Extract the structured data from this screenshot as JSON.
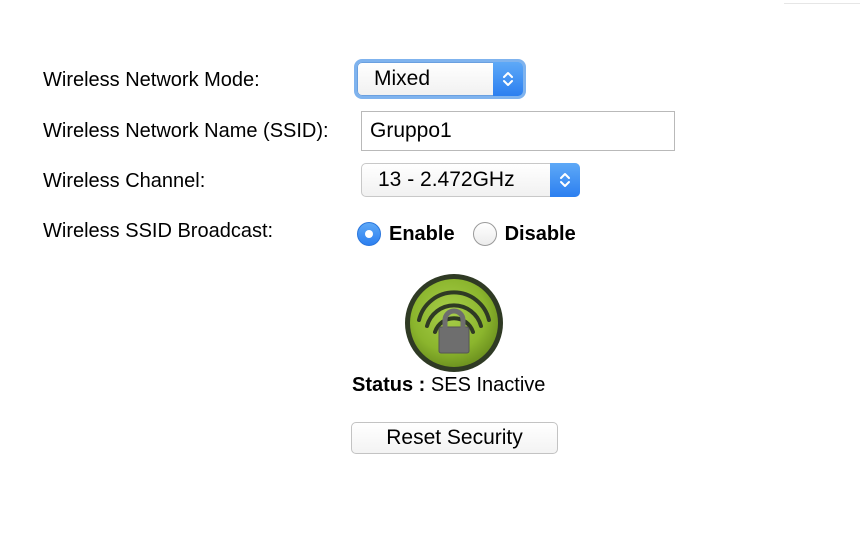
{
  "form": {
    "mode_label": "Wireless Network Mode:",
    "mode_value": "Mixed",
    "ssid_label": "Wireless Network Name (SSID):",
    "ssid_value": "Gruppo1",
    "channel_label": "Wireless Channel:",
    "channel_value": "13 - 2.472GHz",
    "broadcast_label": "Wireless SSID Broadcast:",
    "broadcast_options": [
      {
        "label": "Enable",
        "checked": true
      },
      {
        "label": "Disable",
        "checked": false
      }
    ]
  },
  "ses": {
    "icon": "wireless-lock-icon",
    "status_label": "Status :",
    "status_value": "SES Inactive"
  },
  "reset_button_label": "Reset Security",
  "colors": {
    "accent_blue": "#2c7ff0",
    "focus_ring": "#7fb3ee",
    "ses_green": "#8bb52d"
  }
}
